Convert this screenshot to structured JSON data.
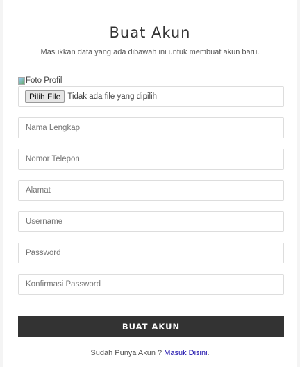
{
  "header": {
    "title": "Buat Akun",
    "subtitle": "Masukkan data yang ada dibawah ini untuk membuat akun baru."
  },
  "photo": {
    "alt": "Foto Profil",
    "choose_label": "Pilih File",
    "no_file": "Tidak ada file yang dipilih"
  },
  "fields": [
    {
      "placeholder": "Nama Lengkap"
    },
    {
      "placeholder": "Nomor Telepon"
    },
    {
      "placeholder": "Alamat"
    },
    {
      "placeholder": "Username"
    },
    {
      "placeholder": "Password"
    },
    {
      "placeholder": "Konfirmasi Password"
    }
  ],
  "submit_label": "BUAT AKUN",
  "footer": {
    "text": "Sudah Punya Akun ? ",
    "link": "Masuk Disini",
    "end": "."
  },
  "colors": {
    "button": "#333333",
    "link": "#1a0dab"
  }
}
